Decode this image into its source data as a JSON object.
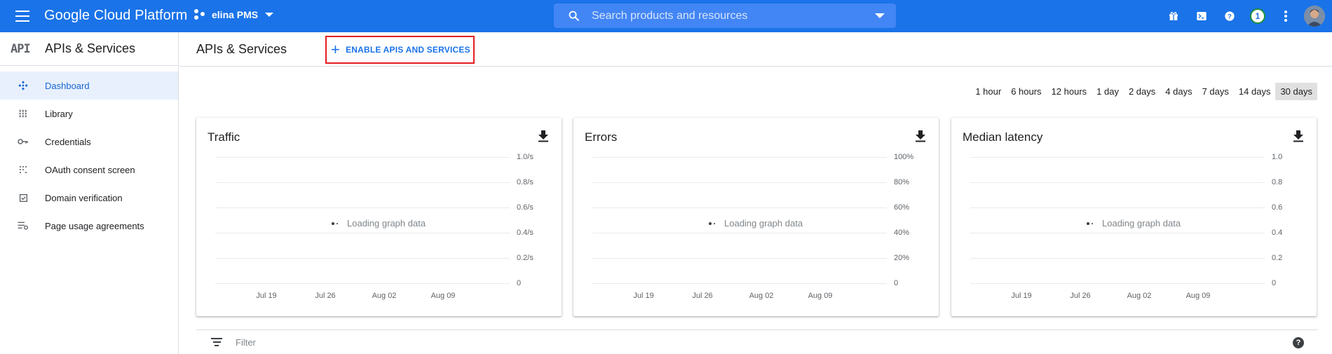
{
  "topbar": {
    "brand": "Google Cloud Platform",
    "project": "elina PMS",
    "search_placeholder": "Search products and resources",
    "notification_count": "1",
    "colors": {
      "bar": "#1a73e8",
      "search_bg": "#4285f4"
    },
    "icons": [
      "menu-icon",
      "project-dots-icon",
      "search-icon",
      "gift-icon",
      "cloud-shell-icon",
      "help-icon",
      "more-vert-icon"
    ]
  },
  "sidebar": {
    "title": "APIs & Services",
    "logo": "API",
    "items": [
      {
        "label": "Dashboard",
        "icon": "dashboard-icon",
        "active": true
      },
      {
        "label": "Library",
        "icon": "library-icon"
      },
      {
        "label": "Credentials",
        "icon": "key-icon"
      },
      {
        "label": "OAuth consent screen",
        "icon": "oauth-icon"
      },
      {
        "label": "Domain verification",
        "icon": "checkbox-icon"
      },
      {
        "label": "Page usage agreements",
        "icon": "settings-list-icon"
      }
    ]
  },
  "header": {
    "title": "APIs & Services",
    "enable_button": "ENABLE APIS AND SERVICES"
  },
  "time_ranges": {
    "options": [
      "1 hour",
      "6 hours",
      "12 hours",
      "1 day",
      "2 days",
      "4 days",
      "7 days",
      "14 days",
      "30 days"
    ],
    "selected": "30 days"
  },
  "cards": [
    {
      "title": "Traffic",
      "loading": "Loading graph data",
      "yticks": [
        "1.0/s",
        "0.8/s",
        "0.6/s",
        "0.4/s",
        "0.2/s",
        "0"
      ],
      "xticks": [
        "Jul 19",
        "Jul 26",
        "Aug 02",
        "Aug 09"
      ]
    },
    {
      "title": "Errors",
      "loading": "Loading graph data",
      "yticks": [
        "100%",
        "80%",
        "60%",
        "40%",
        "20%",
        "0"
      ],
      "xticks": [
        "Jul 19",
        "Jul 26",
        "Aug 02",
        "Aug 09"
      ]
    },
    {
      "title": "Median latency",
      "loading": "Loading graph data",
      "yticks": [
        "1.0",
        "0.8",
        "0.6",
        "0.4",
        "0.2",
        "0"
      ],
      "xticks": [
        "Jul 19",
        "Jul 26",
        "Aug 02",
        "Aug 09"
      ]
    }
  ],
  "filter": {
    "placeholder": "Filter"
  }
}
